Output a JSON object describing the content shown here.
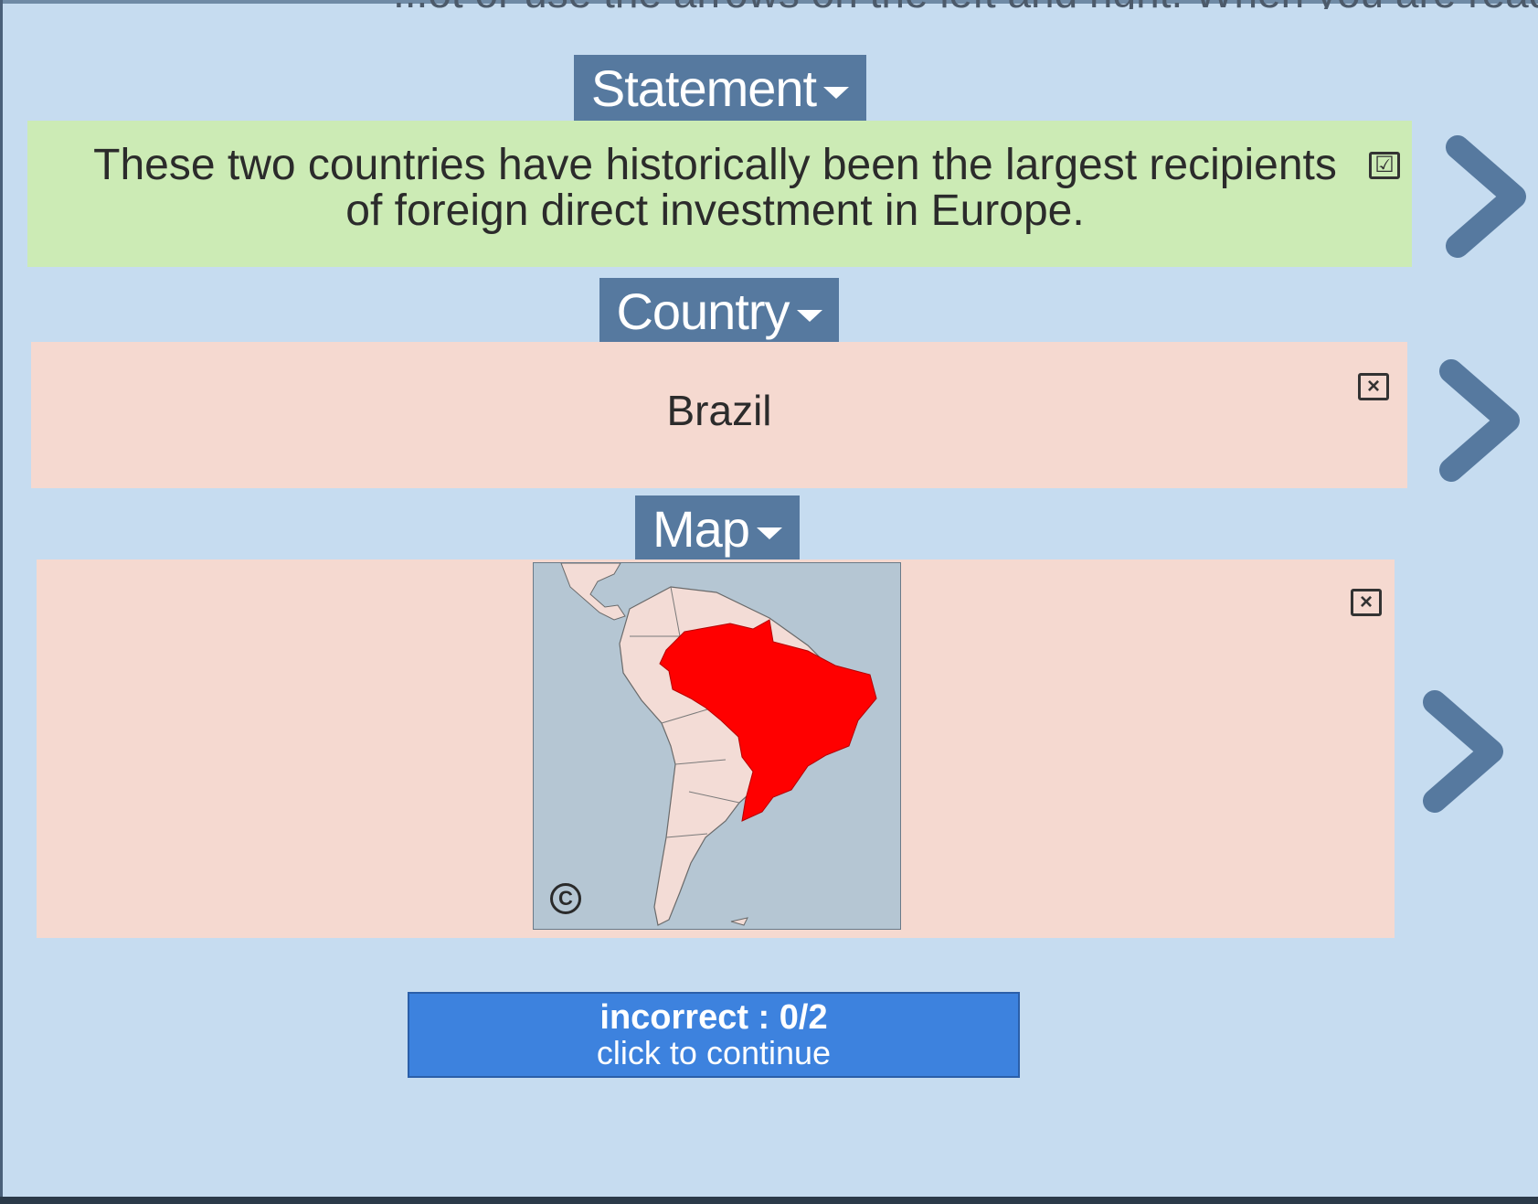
{
  "header": {
    "cutoff_text": "...ot or use the arrows on the left and right. When you are ready to"
  },
  "sections": {
    "statement": {
      "tab_label": "Statement",
      "text": "These two countries have historically been the largest recipients of foreign direct investment in Europe.",
      "status_mark": "☑",
      "status": "correct"
    },
    "country": {
      "tab_label": "Country",
      "text": "Brazil",
      "status_mark": "×",
      "status": "incorrect"
    },
    "map": {
      "tab_label": "Map",
      "copyright_symbol": "C",
      "highlighted_country": "Brazil",
      "status_mark": "×",
      "status": "incorrect"
    }
  },
  "result": {
    "score_text": "incorrect : 0/2",
    "action_text": "click to continue"
  },
  "colors": {
    "background": "#c6dcf0",
    "tab": "#56799f",
    "correct_card": "#ccebb5",
    "incorrect_card": "#f5d9d0",
    "highlight": "#ff0000",
    "button": "#3d82de"
  },
  "icons": {
    "tab_caret": "caret-down-icon",
    "next": "chevron-right-icon",
    "correct": "checkbox-checked-icon",
    "incorrect": "checkbox-x-icon"
  }
}
